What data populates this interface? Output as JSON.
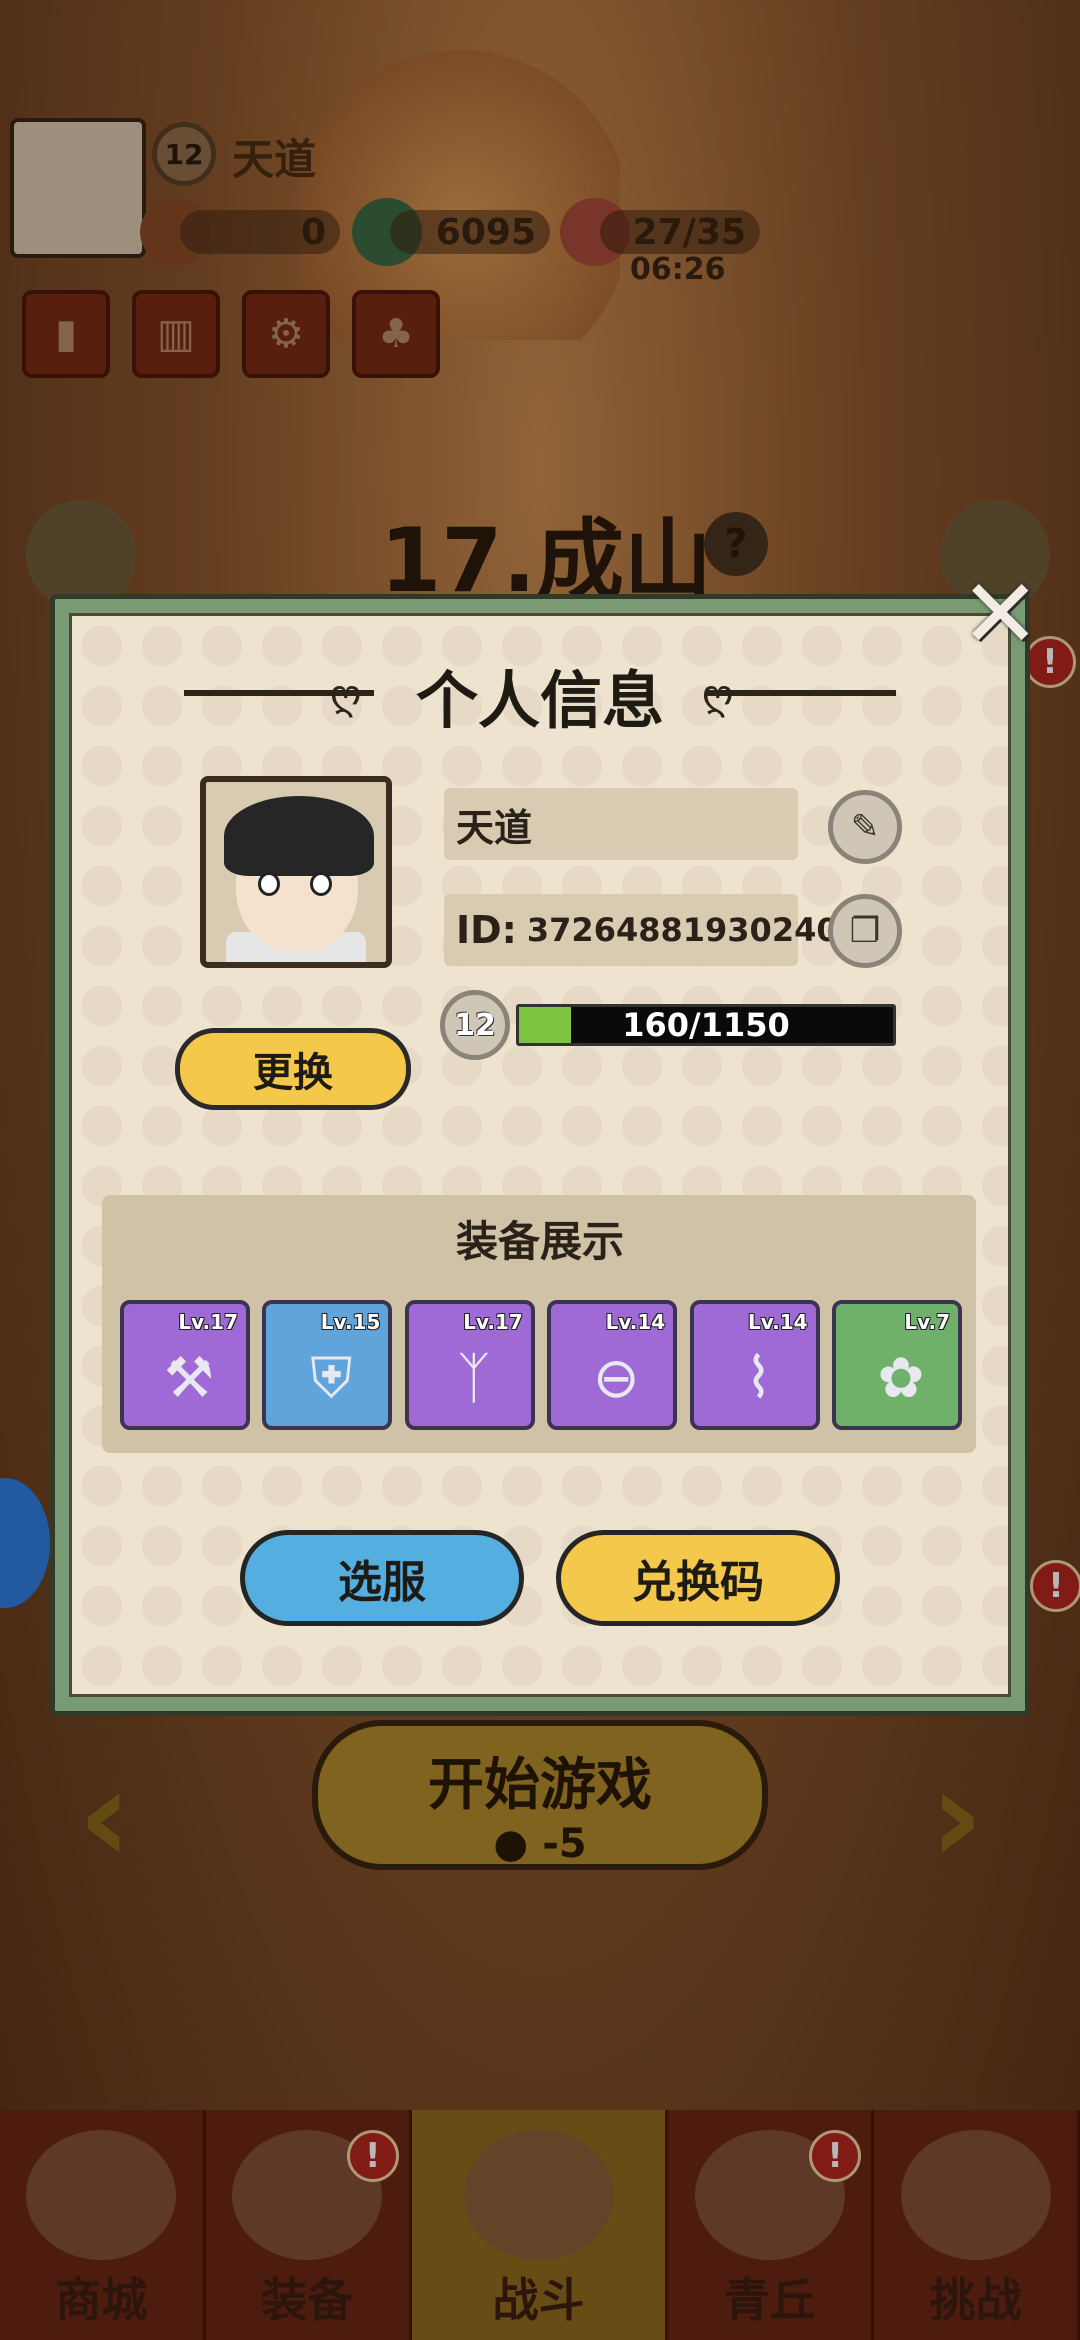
{
  "player": {
    "name": "天道",
    "level": "12",
    "id_label": "ID:",
    "id_value": "372648819302400",
    "xp_text": "160/1150",
    "xp_fraction": 0.139
  },
  "resources": {
    "currency1": "0",
    "currency2": "6095",
    "stamina": "27/35",
    "stamina_timer": "06:26"
  },
  "stage": {
    "title": "17.成山",
    "help": "?"
  },
  "dialog": {
    "title": "个人信息",
    "change_label": "更换",
    "edit_icon": "brush-icon",
    "copy_icon": "copy-icon",
    "close_icon": "close-icon",
    "equip_title": "装备展示",
    "server_label": "选服",
    "redeem_label": "兑换码"
  },
  "equipment": [
    {
      "level": "Lv.17",
      "rarity": "purple",
      "icon": "weapon-icon"
    },
    {
      "level": "Lv.15",
      "rarity": "blue",
      "icon": "armor-icon"
    },
    {
      "level": "Lv.17",
      "rarity": "purple",
      "icon": "claw-icon"
    },
    {
      "level": "Lv.14",
      "rarity": "purple",
      "icon": "belt-icon"
    },
    {
      "level": "Lv.14",
      "rarity": "purple",
      "icon": "boots-icon"
    },
    {
      "level": "Lv.7",
      "rarity": "green",
      "icon": "gem-icon"
    }
  ],
  "start": {
    "label": "开始游戏",
    "cost": "-5"
  },
  "nav": [
    {
      "label": "商城"
    },
    {
      "label": "装备"
    },
    {
      "label": "战斗"
    },
    {
      "label": "青丘"
    },
    {
      "label": "挑战"
    }
  ],
  "badges": {
    "alert": "!"
  },
  "colors": {
    "dialog_border": "#7a9a74",
    "xp_fill": "#7cc342",
    "server_button": "#55aee0",
    "redeem_button": "#f4c84a",
    "rarity_purple": "#a06ad6",
    "rarity_blue": "#5fa4da",
    "rarity_green": "#6fb06a"
  }
}
